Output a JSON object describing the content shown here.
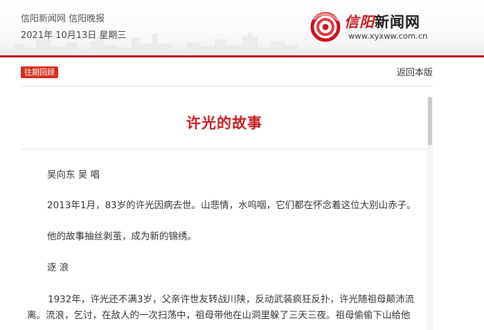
{
  "header": {
    "site_names": "信阳新闻网 信阳晚报",
    "issue_date": "2021年 10月13日 星期三",
    "logo": {
      "brand_red": "信阳",
      "brand_black": "新闻网",
      "url": "www.xyxww.com.cn"
    }
  },
  "toolbar": {
    "archive_badge": "往期回顾",
    "back_link": "返回本版"
  },
  "article": {
    "title": "许光的故事",
    "paragraphs": [
      "吴向东 吴 唱",
      "2013年1月，83岁的许光因病去世。山悲情，水呜咽，它们都在怀念着这位大别山赤子。",
      "他的故事抽丝剥茧，成为新的锦绣。",
      "逐 浪",
      "1932年，许光还不满3岁，父亲许世友转战川陕，反动武装疯狂反扑，许光随祖母颠沛流离。流浪，乞讨，在敌人的一次扫荡中，祖母带他在山洞里躲了三天三夜。祖母偷偷下山给他"
    ]
  },
  "colors": {
    "brand_red": "#c8161d",
    "title_red": "#c41a1e",
    "badge_red": "#d32f1f",
    "header_line": "#b8111b"
  }
}
